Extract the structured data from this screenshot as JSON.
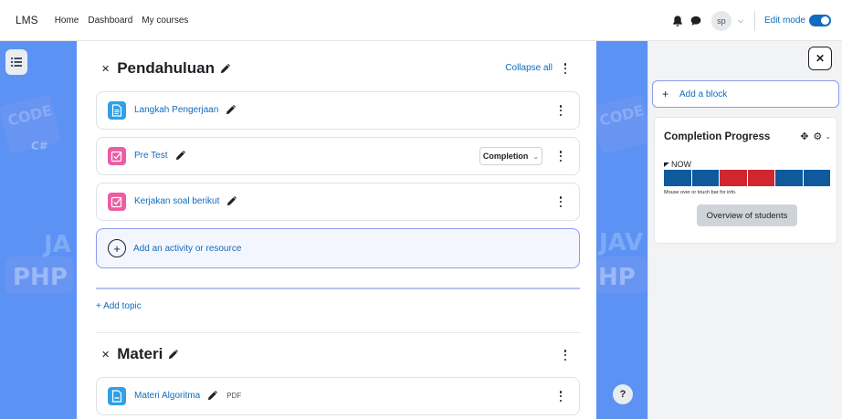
{
  "navbar": {
    "brand": "LMS",
    "links": [
      "Home",
      "Dashboard",
      "My courses"
    ],
    "avatar_initials": "sp",
    "edit_mode_label": "Edit mode",
    "edit_mode_on": true
  },
  "sections": [
    {
      "title": "Pendahuluan",
      "collapse_all": "Collapse all",
      "activities": [
        {
          "name": "Langkah Pengerjaan",
          "icon": "page-icon",
          "color": "#2fa0e6"
        },
        {
          "name": "Pre Test",
          "icon": "quiz-icon",
          "color": "#ec5da3",
          "completion_label": "Completion"
        },
        {
          "name": "Kerjakan soal berikut",
          "icon": "quiz-icon",
          "color": "#ec5da3"
        }
      ],
      "add_activity": "Add an activity or resource",
      "add_topic": "+ Add topic"
    },
    {
      "title": "Materi",
      "activities": [
        {
          "name": "Materi Algoritma",
          "icon": "pdf-file-icon",
          "color": "#2fa0e6",
          "tag": "PDF"
        }
      ]
    }
  ],
  "drawer": {
    "add_block": "Add a block",
    "block": {
      "title": "Completion Progress",
      "now_label": "NOW",
      "segments": [
        "#0e5a9c",
        "#0e5a9c",
        "#d1262f",
        "#d1262f",
        "#0e5a9c",
        "#0e5a9c"
      ],
      "hint": "Mouse over or touch bar for info.",
      "overview_button": "Overview of students"
    }
  },
  "help_label": "?",
  "colors": {
    "accent": "#0f6cbf",
    "background": "#5b92f4"
  }
}
